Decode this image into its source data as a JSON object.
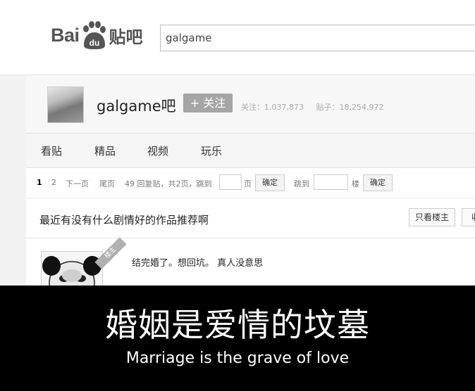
{
  "header": {
    "logo_bai": "Bai",
    "logo_du": "du",
    "logo_tieba": "贴吧",
    "search_value": "galgame"
  },
  "forum": {
    "name": "galgame吧",
    "follow_label": "+ 关注",
    "followers_label": "关注：",
    "followers_value": "1,037,873",
    "posts_label": "贴子：",
    "posts_value": "18,254,972"
  },
  "nav": {
    "items": [
      "看贴",
      "精品",
      "视频",
      "玩乐"
    ]
  },
  "pager": {
    "page1": "1",
    "page2": "2",
    "next": "下一页",
    "last": "尾页",
    "summary": "49 回复贴，共2页，跳到",
    "page_unit": "页",
    "confirm1": "确定",
    "jump_to": "跳到",
    "floor_unit": "楼",
    "confirm2": "确定"
  },
  "thread": {
    "title": "最近有没有什么剧情好的作品推荐啊",
    "only_op_button": "只看楼主",
    "collect_button": "收",
    "op_badge": "楼主",
    "first_post": "结完婚了。想回坑。 真人没意思"
  },
  "caption": {
    "chinese": "婚姻是爱情的坟墓",
    "english": "Marriage is the grave of love"
  }
}
